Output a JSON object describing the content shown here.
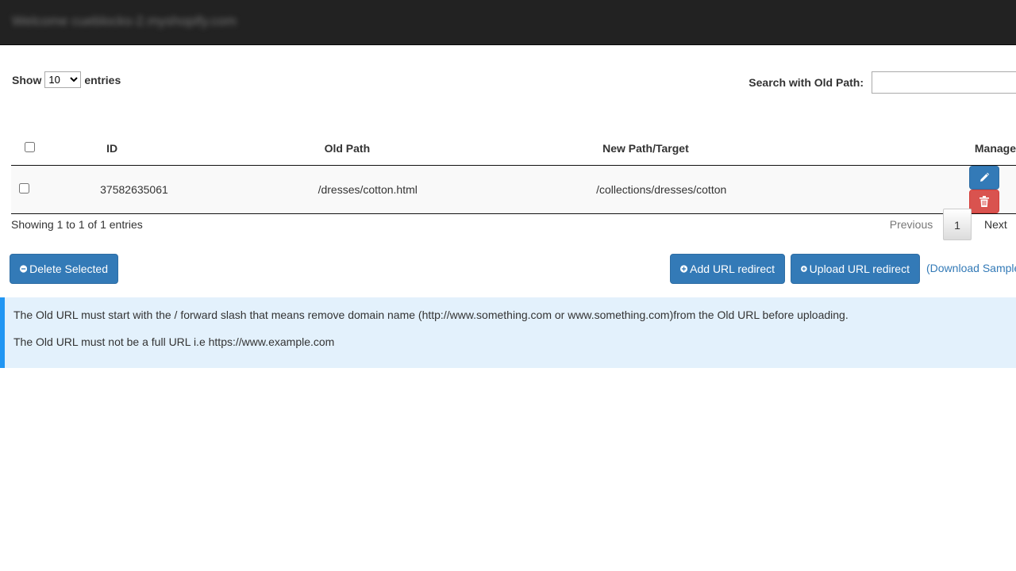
{
  "topbar": {
    "welcome_text": "Welcome cueblocks-2.myshopify.com"
  },
  "length": {
    "show_label": "Show",
    "selected": "10",
    "options": [
      "10"
    ],
    "entries_label": "entries"
  },
  "search": {
    "label": "Search with Old Path:",
    "value": ""
  },
  "table": {
    "headers": {
      "id": "ID",
      "old_path": "Old Path",
      "new_path": "New Path/Target",
      "manage": "Manage"
    },
    "rows": [
      {
        "id": "37582635061",
        "old_path": "/dresses/cotton.html",
        "new_path": "/collections/dresses/cotton"
      }
    ]
  },
  "info": "Showing 1 to 1 of 1 entries",
  "pagination": {
    "previous": "Previous",
    "page": "1",
    "next": "Next"
  },
  "actions": {
    "delete_selected": "Delete Selected",
    "add_redirect": "Add URL redirect",
    "upload_redirect": "Upload URL redirect",
    "download_sample": "(Download Sample"
  },
  "notice": {
    "line1": "The Old URL must start with the / forward slash that means remove domain name (http://www.something.com or www.something.com)from the Old URL before uploading.",
    "line2": "The Old URL must not be a full URL i.e https://www.example.com"
  },
  "icons": {
    "edit": "pencil-icon",
    "delete": "trash-icon",
    "delete_selected": "minus-circle-icon",
    "add": "plus-circle-icon",
    "upload": "plus-circle-icon"
  },
  "colors": {
    "topbar": "#222222",
    "primary": "#337ab7",
    "danger": "#d9534f",
    "notice_bg": "#e3f1fc",
    "notice_border": "#2196f3"
  }
}
